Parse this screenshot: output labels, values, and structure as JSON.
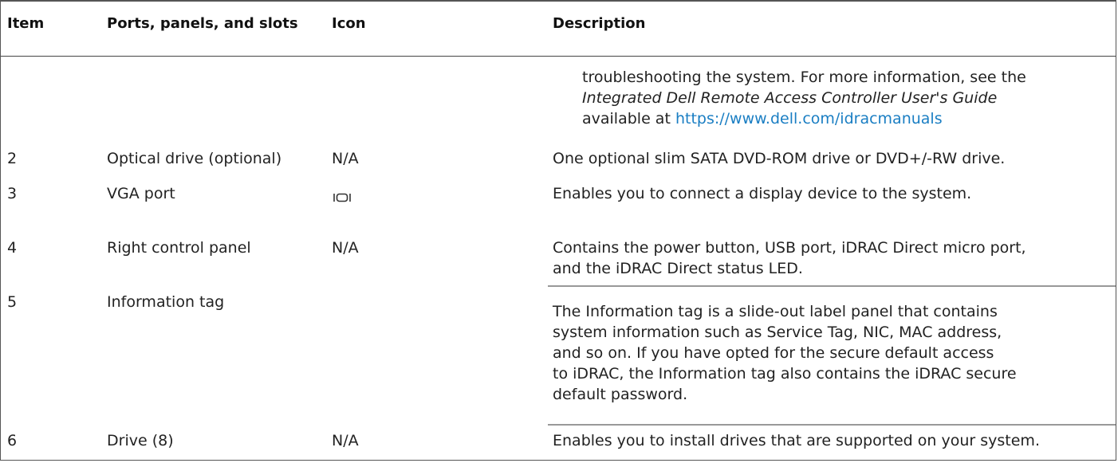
{
  "header": {
    "item": "Item",
    "ports": "Ports, panels, and slots",
    "icon": "Icon",
    "description": "Description"
  },
  "continuation": {
    "line1": "troubleshooting the system. For more information, see the",
    "guide": "Integrated Dell Remote Access Controller User's Guide",
    "available": "available at",
    "link": "https://www.dell.com/idracmanuals"
  },
  "rows": [
    {
      "item": "2",
      "port": "Optical drive (optional)",
      "icon": "N/A",
      "desc": "One optional slim SATA DVD-ROM drive or DVD+/-RW drive."
    },
    {
      "item": "3",
      "port": "VGA port",
      "icon": "vga-port-icon",
      "desc": "Enables you to connect a display device to the system."
    },
    {
      "item": "4",
      "port": "Right control panel",
      "icon": "N/A",
      "desc_lines": [
        "Contains the power button, USB port, iDRAC Direct micro port,",
        "and the iDRAC Direct status LED."
      ]
    },
    {
      "item": "5",
      "port": "Information tag",
      "icon": "",
      "desc_lines": [
        "The Information tag is a slide-out label panel that contains",
        "system information such as Service Tag, NIC, MAC address,",
        "and so on. If you have opted for the secure default access",
        "to iDRAC, the Information tag also contains the iDRAC secure",
        "default password."
      ]
    },
    {
      "item": "6",
      "port": "Drive (8)",
      "icon": "N/A",
      "desc": "Enables you to install drives that are supported on your system."
    }
  ]
}
